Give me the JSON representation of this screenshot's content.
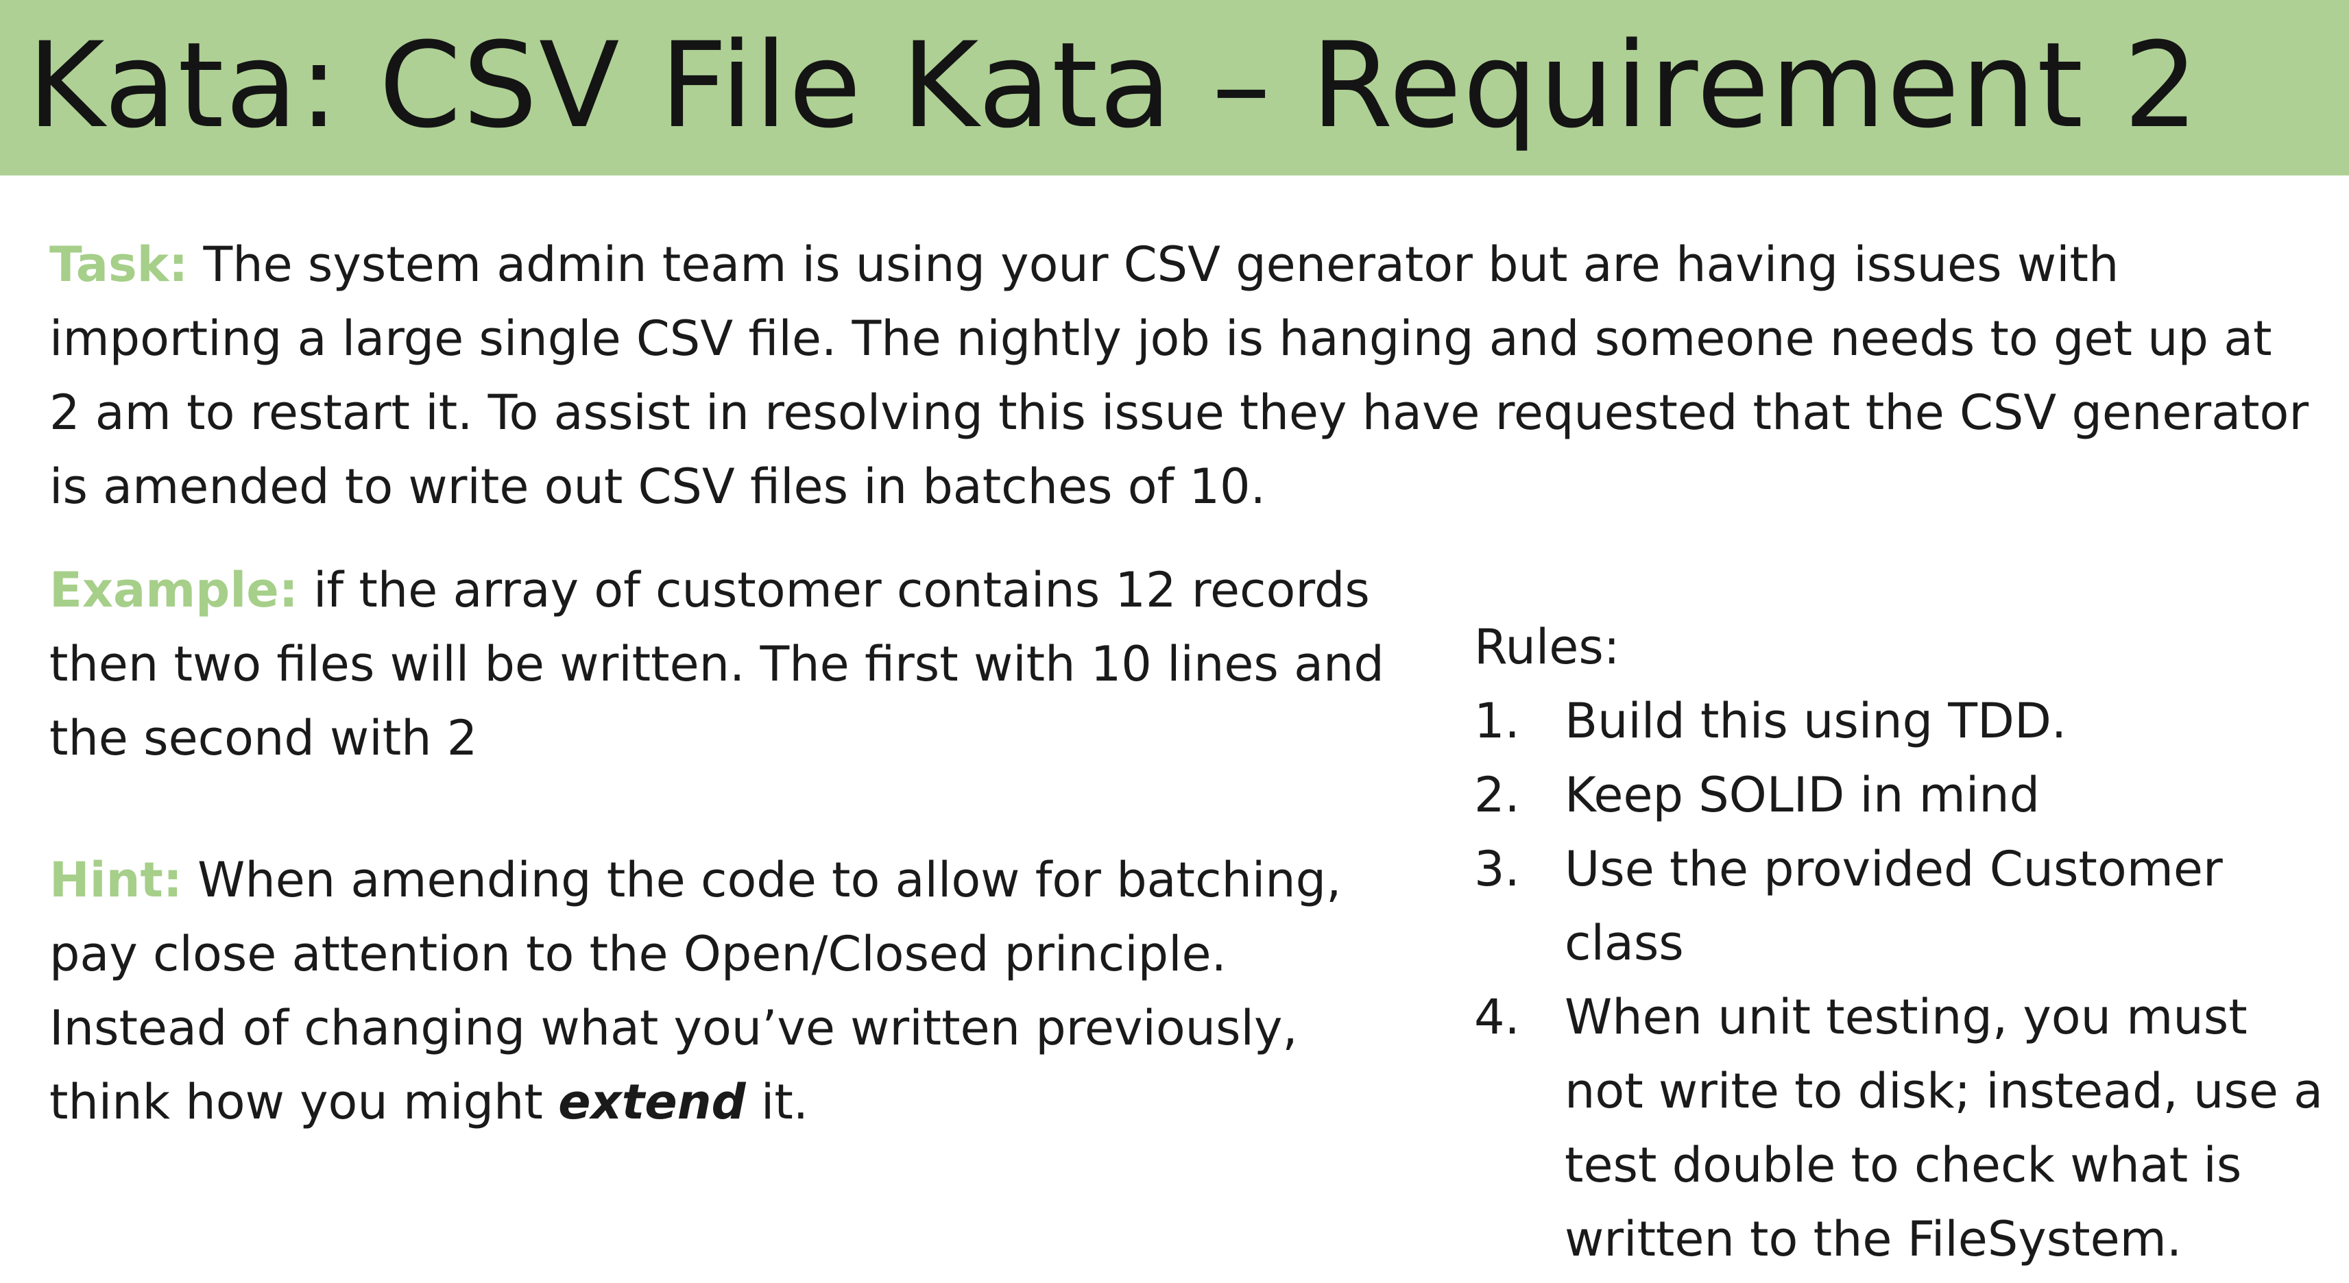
{
  "title": "Kata: CSV File Kata – Requirement 2",
  "task": {
    "label": "Task:",
    "text": "The system admin team is using your CSV generator but are having issues with importing a large single CSV file. The nightly job is hanging and someone needs to get up at 2 am to restart it. To assist in resolving this issue they have requested that the CSV generator is amended to write out CSV files in batches of 10."
  },
  "example": {
    "label": "Example:",
    "text": "if the array of customer contains 12 records then two files will be written. The first with 10 lines and the second with 2"
  },
  "hint": {
    "label": "Hint:",
    "text_before": "When amending the code to allow for batching, pay close attention to the Open/Closed principle. Instead of changing what you’ve written previously, think how you might",
    "emphasis": "extend",
    "text_after": "it."
  },
  "rules": {
    "title": "Rules:",
    "items": [
      {
        "num": "1.",
        "text": "Build this using TDD."
      },
      {
        "num": "2.",
        "text": "Keep SOLID in mind"
      },
      {
        "num": "3.",
        "text": "Use the provided Customer class"
      },
      {
        "num": "4.",
        "text": "When unit testing, you must not write to disk; instead, use a test double to check what is written to the FileSystem."
      }
    ]
  },
  "colors": {
    "title_bar": "#aed094",
    "label": "#a6cf8a",
    "text": "#1a1a1a"
  }
}
